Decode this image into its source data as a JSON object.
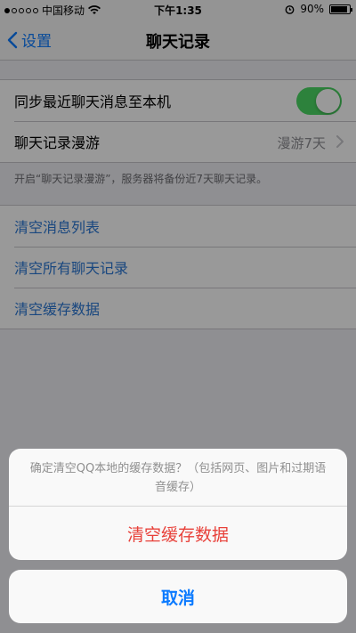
{
  "status_bar": {
    "carrier": "中国移动",
    "time": "下午1:35",
    "battery": "90%",
    "battery_level": 0.9
  },
  "nav": {
    "back_label": "设置",
    "title": "聊天记录"
  },
  "settings": {
    "sync_label": "同步最近聊天消息至本机",
    "sync_enabled": true,
    "roaming_label": "聊天记录漫游",
    "roaming_value": "漫游7天",
    "footnote": "开启“聊天记录漫游”，服务器将备份近7天聊天记录。"
  },
  "actions": {
    "clear_message_list": "清空消息列表",
    "clear_all_chats": "清空所有聊天记录",
    "clear_cache": "清空缓存数据"
  },
  "action_sheet": {
    "message": "确定清空QQ本地的缓存数据？（包括网页、图片和过期语音缓存）",
    "destructive_label": "清空缓存数据",
    "cancel_label": "取消"
  },
  "colors": {
    "accent": "#0a7aff",
    "link": "#2a77d4",
    "destructive": "#e8413a",
    "toggle_on": "#4cd964"
  }
}
